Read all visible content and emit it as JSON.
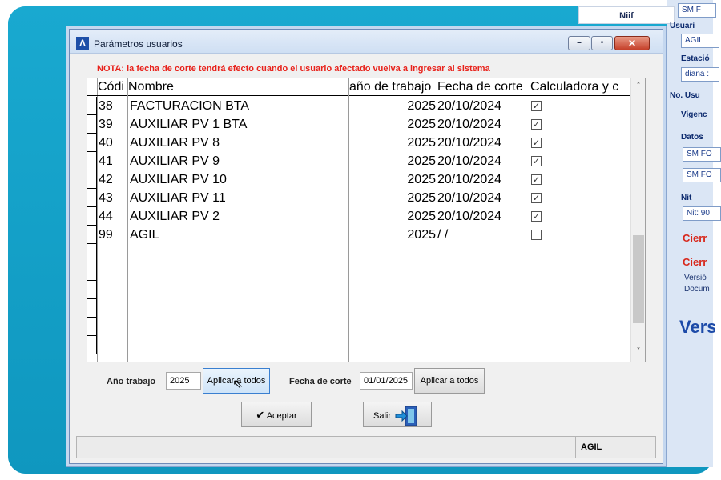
{
  "background_app": {
    "niif_label": "Niif",
    "sm_top": "SM F",
    "usuario_label": "Usuari",
    "usuario_value": "AGIL",
    "estacion_label": "Estació",
    "estacion_value": "diana :",
    "no_usu_label": "No. Usu",
    "vigencia_label": "Vigenc",
    "datos_label": "Datos",
    "datos_value_1": "SM FO",
    "datos_value_2": "SM FO",
    "nit_label": "Nit",
    "nit_value": "Nit: 90",
    "cierre_1": "Cierr",
    "cierre_2": "Cierr",
    "version_label": "Versió",
    "docum_label": "Docum",
    "vers_big": "Vers"
  },
  "dialog": {
    "title": "Parámetros usuarios",
    "note": "NOTA: la fecha de corte tendrá efecto cuando el usuario afectado vuelva a ingresar al sistema",
    "window_buttons": {
      "minimize": "–",
      "maximize": "▫",
      "close": "✕"
    },
    "grid": {
      "headers": {
        "codigo": "Códi",
        "nombre": "Nombre",
        "anio": "año de trabajo",
        "fecha": "Fecha de corte",
        "calc": "Calculadora y c"
      },
      "rows": [
        {
          "codigo": "38",
          "nombre": "FACTURACION BTA",
          "anio": "2025",
          "fecha": "20/10/2024",
          "checked": true
        },
        {
          "codigo": "39",
          "nombre": "AUXILIAR PV 1 BTA",
          "anio": "2025",
          "fecha": "20/10/2024",
          "checked": true
        },
        {
          "codigo": "40",
          "nombre": "AUXILIAR PV 8",
          "anio": "2025",
          "fecha": "20/10/2024",
          "checked": true
        },
        {
          "codigo": "41",
          "nombre": "AUXILIAR PV 9",
          "anio": "2025",
          "fecha": "20/10/2024",
          "checked": true
        },
        {
          "codigo": "42",
          "nombre": "AUXILIAR PV 10",
          "anio": "2025",
          "fecha": "20/10/2024",
          "checked": true
        },
        {
          "codigo": "43",
          "nombre": "AUXILIAR PV 11",
          "anio": "2025",
          "fecha": "20/10/2024",
          "checked": true
        },
        {
          "codigo": "44",
          "nombre": "AUXILIAR PV 2",
          "anio": "2025",
          "fecha": "20/10/2024",
          "checked": true
        },
        {
          "codigo": "99",
          "nombre": "AGIL",
          "anio": "2025",
          "fecha": " /  /",
          "checked": false
        }
      ],
      "scroll_up": "˄",
      "scroll_down": "˅"
    },
    "controls": {
      "anio_label": "Año trabajo",
      "anio_value": "2025",
      "apply_anio": "Aplicar a todos",
      "fecha_label": "Fecha de corte",
      "fecha_value": "01/01/2025",
      "apply_fecha": "Aplicar a todos",
      "aceptar": "Aceptar",
      "salir": "Salir"
    },
    "status": {
      "user": "AGIL"
    }
  }
}
